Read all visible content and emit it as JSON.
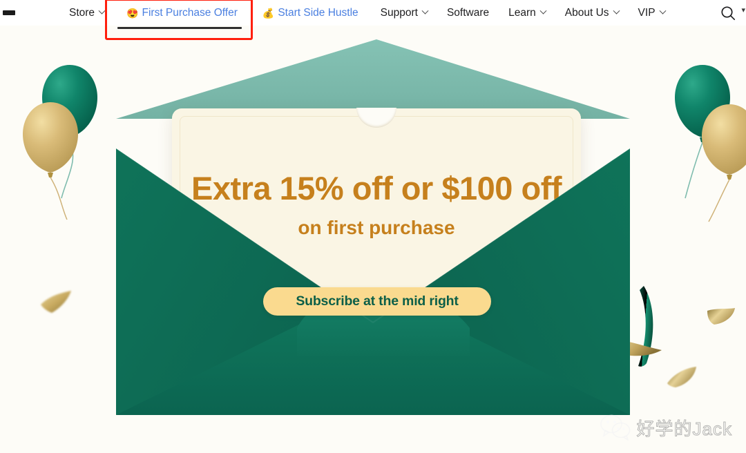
{
  "nav": {
    "logo_icon": "logo-dash-mark",
    "items": [
      {
        "label": "Store",
        "icon": "",
        "has_dropdown": true,
        "highlight": false
      },
      {
        "label": "First Purchase Offer",
        "icon": "😍",
        "has_dropdown": false,
        "highlight": true
      },
      {
        "label": "Start Side Hustle",
        "icon": "💰",
        "has_dropdown": false,
        "highlight": true
      },
      {
        "label": "Support",
        "icon": "",
        "has_dropdown": true,
        "highlight": false
      },
      {
        "label": "Software",
        "icon": "",
        "has_dropdown": false,
        "highlight": false
      },
      {
        "label": "Learn",
        "icon": "",
        "has_dropdown": true,
        "highlight": false
      },
      {
        "label": "About Us",
        "icon": "",
        "has_dropdown": true,
        "highlight": false
      },
      {
        "label": "VIP",
        "icon": "",
        "has_dropdown": true,
        "highlight": false
      }
    ],
    "search_icon": "search-icon",
    "edge_glyph": "▾",
    "active_underline_for": "First Purchase Offer"
  },
  "annotation": {
    "type": "red-highlight-box",
    "target": "First Purchase Offer",
    "color": "#ff1f0d"
  },
  "hero": {
    "headline": "Extra 15% off or $100 off",
    "subheadline": "on first purchase",
    "cta_label": "Subscribe at the mid right",
    "headline_color": "#c6801d",
    "cta_bg_color": "#fada8f",
    "cta_text_color": "#0c5f48",
    "envelope_color": "#0e7058",
    "flap_color": "#7bbcae",
    "card_color": "#faf5e4",
    "background_color": "#fdfcf7",
    "decorations": [
      "balloon-green-left",
      "balloon-gold-left",
      "balloon-green-right",
      "balloon-gold-right",
      "confetti-gold-left",
      "confetti-gold-right-upper",
      "confetti-gold-right-lower",
      "ribbon-green-right",
      "ribbon-gold-right"
    ]
  },
  "watermark": {
    "icon": "wechat-icon",
    "text": "好学的Jack"
  }
}
